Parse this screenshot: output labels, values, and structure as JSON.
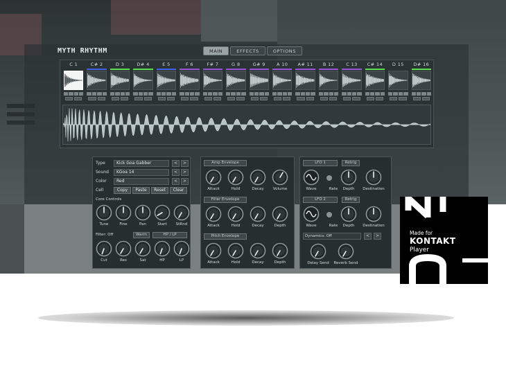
{
  "app": {
    "title": "MYTH RHYTHM"
  },
  "tabs": [
    {
      "label": "MAIN",
      "active": true
    },
    {
      "label": "EFFECTS",
      "active": false
    },
    {
      "label": "OPTIONS",
      "active": false
    }
  ],
  "pads": [
    {
      "label": "C 1",
      "color": "none",
      "selected": true
    },
    {
      "label": "C# 2",
      "color": "blue"
    },
    {
      "label": "D 3",
      "color": "green"
    },
    {
      "label": "D# 4",
      "color": "green"
    },
    {
      "label": "E 5",
      "color": "blue"
    },
    {
      "label": "F 6",
      "color": "purple"
    },
    {
      "label": "F# 7",
      "color": "purple"
    },
    {
      "label": "G 8",
      "color": "purple"
    },
    {
      "label": "G# 9",
      "color": "purple"
    },
    {
      "label": "A 10",
      "color": "purple"
    },
    {
      "label": "A# 11",
      "color": "purple"
    },
    {
      "label": "B 12",
      "color": "purple"
    },
    {
      "label": "C 13",
      "color": "purple"
    },
    {
      "label": "C# 14",
      "color": "green"
    },
    {
      "label": "D 15",
      "color": "none"
    },
    {
      "label": "D# 16",
      "color": "green"
    }
  ],
  "sound": {
    "type_label": "Type",
    "type_value": "Kick Goa Gabber",
    "sound_label": "Sound",
    "sound_value": "KGoa 14",
    "color_label": "Color",
    "color_value": "Red",
    "cell_label": "Cell",
    "copy_label": "Copy",
    "paste_label": "Paste",
    "reset_label": "Reset",
    "clear_label": "Clear",
    "prev": "<",
    "next": ">"
  },
  "core": {
    "title": "Core Controls",
    "knobs": [
      "Tune",
      "Fine",
      "Pan",
      "Start",
      "StRnd"
    ]
  },
  "filter": {
    "label": "Filter: Off",
    "warm_label": "Warm",
    "mode_label": "HP / LP",
    "knobs": [
      "Cut",
      "Res",
      "Sat",
      "HP",
      "LP"
    ]
  },
  "envelopes": [
    {
      "title": "Amp Envelope",
      "knobs": [
        "Attack",
        "Hold",
        "Decay",
        "Volume"
      ]
    },
    {
      "title": "Filter Envelope",
      "knobs": [
        "Attack",
        "Hold",
        "Decay",
        "Depth"
      ]
    },
    {
      "title": "Pitch Envelope",
      "knobs": [
        "Attack",
        "Hold",
        "Decay",
        "Depth"
      ]
    }
  ],
  "lfos": [
    {
      "title": "LFO 1",
      "retrig": "Retrig",
      "knobs": [
        "Wave",
        "Rate",
        "Depth",
        "Destination"
      ]
    },
    {
      "title": "LFO 2",
      "retrig": "Retrig",
      "knobs": [
        "Wave",
        "Rate",
        "Depth",
        "Destination"
      ]
    }
  ],
  "dynamics": {
    "label": "Dynamics: Off",
    "prev": "<",
    "next": ">",
    "knobs": [
      "Delay Send",
      "Reverb Send"
    ]
  },
  "badge": {
    "line1": "Made for",
    "line2": "KONTAKT",
    "line3": "Player"
  },
  "colors": {
    "green": "#59e04a",
    "blue": "#3f5fe8",
    "purple": "#9a52d8"
  }
}
